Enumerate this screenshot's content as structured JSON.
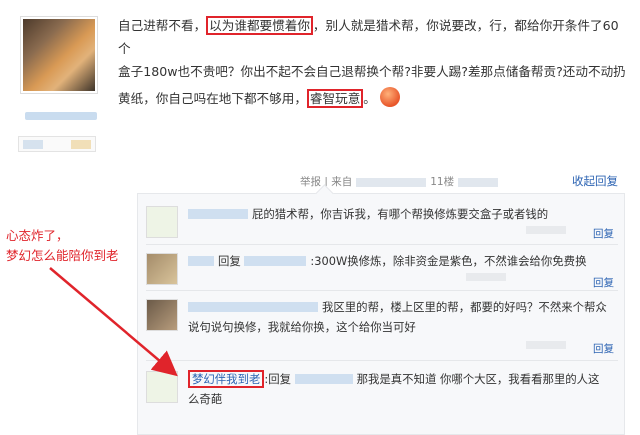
{
  "post": {
    "line1_pre": "自己进帮不看，",
    "line1_hl": "以为谁都要惯着你",
    "line1_post": "，别人就是猎术帮，你说要改，行，都给你开条件了60个",
    "line2": "盒子180w也不贵吧？你出不起不会自己退帮换个帮?非要人踢?差那点储备帮贡?还动不动扔",
    "line3_pre": "黄纸，你自己吗在地下都不够用，",
    "line3_hl": "睿智玩意",
    "line3_post": "。"
  },
  "meta": {
    "report": "举报",
    "from": "来自",
    "floor": "11楼",
    "collapse": "收起回复"
  },
  "replies": [
    {
      "text": "屁的猎术帮，你吉诉我，有哪个帮换修炼要交盒子或者钱的",
      "action": "回复"
    },
    {
      "prefix": "回复",
      "text": ":300W换修炼，除非资金是紫色，不然谁会给你免费换",
      "action": "回复"
    },
    {
      "text": "我区里的帮，楼上区里的帮，都要的好吗？不然来个帮众说句说句换修，我就给你换，这个给你当可好",
      "action": "回复"
    },
    {
      "name": "梦幻伴我到老",
      "prefix": ":回复",
      "text": "那我是真不知道 你哪个大区，我看看那里的人这么奇葩"
    }
  ],
  "annotation": {
    "line1": "心态炸了，",
    "line2": "梦幻怎么能陪你到老"
  },
  "colors": {
    "highlight": "#e0242b",
    "link": "#2d64b3"
  }
}
